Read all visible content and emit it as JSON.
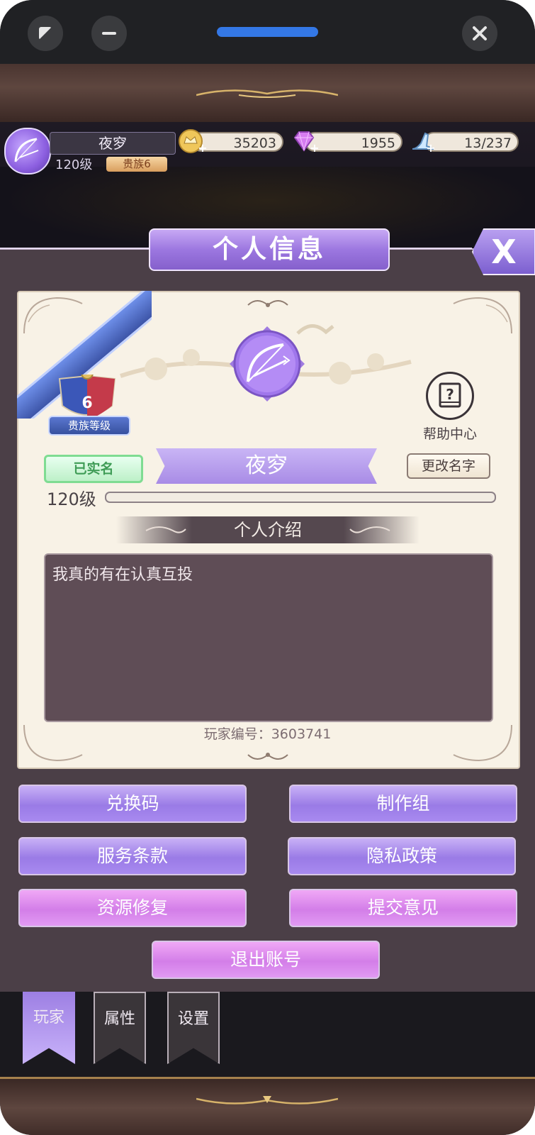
{
  "system": {
    "buttons": [
      "expand-icon",
      "minimize-icon",
      "close-icon"
    ]
  },
  "hud": {
    "player_name": "夜穸",
    "level": "120级",
    "noble": "贵族6",
    "gold": "35203",
    "diamonds": "1955",
    "stamina": "13/237"
  },
  "panel": {
    "title": "个人信息",
    "close_label": "X",
    "badge_number": "6",
    "badge_label": "贵族等级",
    "help_label": "帮助中心",
    "verified_label": "已实名",
    "player_name": "夜穸",
    "rename_label": "更改名字",
    "level": "120级",
    "exp_fraction": 0.0,
    "intro_heading": "个人介绍",
    "intro_text": "我真的有在认真互投",
    "player_id": "玩家编号：3603741"
  },
  "buttons": {
    "redeem": "兑换码",
    "credits": "制作组",
    "terms": "服务条款",
    "privacy": "隐私政策",
    "repair": "资源修复",
    "feedback": "提交意见",
    "logout": "退出账号"
  },
  "tabs": [
    {
      "label": "玩家",
      "active": true
    },
    {
      "label": "属性",
      "active": false
    },
    {
      "label": "设置",
      "active": false
    }
  ],
  "colors": {
    "accent_purple": "#9a7be6",
    "accent_pink": "#d37ee8",
    "panel_bg": "#4b3f47",
    "card_bg": "#f8f2e6"
  }
}
